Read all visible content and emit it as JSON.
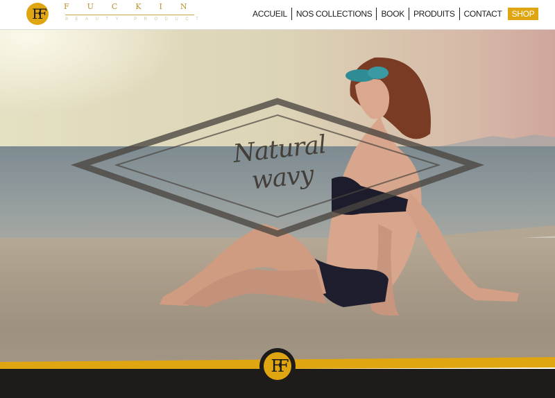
{
  "header": {
    "logo_monogram": "FF",
    "brand_name": "FUCKIN",
    "brand_tagline": "BEAUTY PRODUCT"
  },
  "nav": {
    "items": [
      {
        "label": "ACCUEIL"
      },
      {
        "label": "NOS COLLECTIONS"
      },
      {
        "label": "BOOK"
      },
      {
        "label": "PRODUITS"
      },
      {
        "label": "CONTACT"
      }
    ],
    "shop_label": "SHOP"
  },
  "hero": {
    "tagline": "Natural wavy"
  },
  "footer": {
    "logo_monogram": "FF"
  },
  "colors": {
    "accent": "#e0a611",
    "dark": "#1e1c1b",
    "white": "#ffffff"
  }
}
